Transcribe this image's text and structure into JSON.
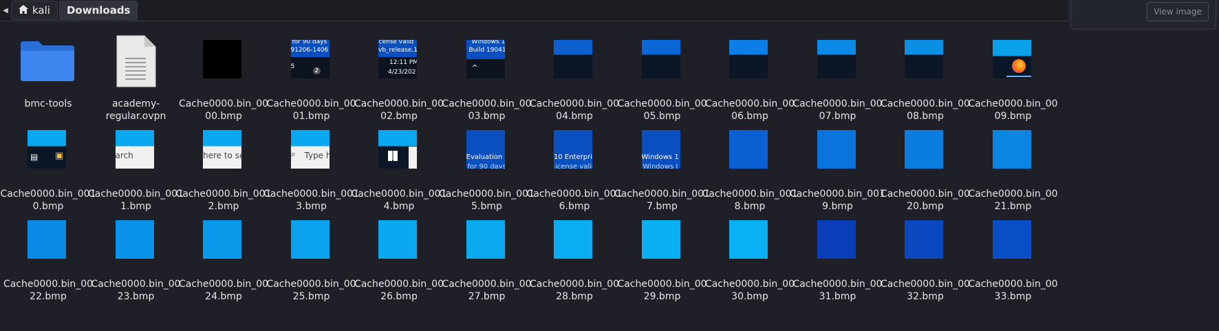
{
  "breadcrumb": {
    "home": "kali",
    "current": "Downloads"
  },
  "view_image_label": "View image",
  "rows": [
    [
      {
        "name": "bmc-tools",
        "kind": "folder"
      },
      {
        "name": "academy-regular.ovpn",
        "kind": "doc",
        "l1": "academy-",
        "l2": "regular.ovpn"
      },
      {
        "l1": "Cache0000.bin_00",
        "l2": "00.bmp",
        "kind": "black"
      },
      {
        "l1": "Cache0000.bin_00",
        "l2": "01.bmp",
        "kind": "thumb01"
      },
      {
        "l1": "Cache0000.bin_00",
        "l2": "02.bmp",
        "kind": "thumb02"
      },
      {
        "l1": "Cache0000.bin_00",
        "l2": "03.bmp",
        "kind": "thumb03"
      },
      {
        "l1": "Cache0000.bin_00",
        "l2": "04.bmp",
        "kind": "split",
        "top": "#0b5fcf",
        "bottom": "#0b1726"
      },
      {
        "l1": "Cache0000.bin_00",
        "l2": "05.bmp",
        "kind": "split",
        "top": "#0a67d8",
        "bottom": "#0b1726"
      },
      {
        "l1": "Cache0000.bin_00",
        "l2": "06.bmp",
        "kind": "split",
        "top": "#0d7de8",
        "bottom": "#0b1726"
      },
      {
        "l1": "Cache0000.bin_00",
        "l2": "07.bmp",
        "kind": "split",
        "top": "#0a8ae6",
        "bottom": "#0b1726"
      },
      {
        "l1": "Cache0000.bin_00",
        "l2": "08.bmp",
        "kind": "split",
        "top": "#0a8fe4",
        "bottom": "#0b1726"
      },
      {
        "l1": "Cache0000.bin_00",
        "l2": "09.bmp",
        "kind": "thumb09"
      }
    ],
    [
      {
        "l1": "Cache0000.bin_001",
        "l2": "0.bmp",
        "kind": "thumb10"
      },
      {
        "l1": "Cache0000.bin_001",
        "l2": "1.bmp",
        "kind": "search",
        "text": "arch"
      },
      {
        "l1": "Cache0000.bin_001",
        "l2": "2.bmp",
        "kind": "search",
        "text": "here to sea"
      },
      {
        "l1": "Cache0000.bin_001",
        "l2": "3.bmp",
        "kind": "search2",
        "text": "Type h"
      },
      {
        "l1": "Cache0000.bin_001",
        "l2": "4.bmp",
        "kind": "thumb14"
      },
      {
        "l1": "Cache0000.bin_001",
        "l2": "5.bmp",
        "kind": "bluetext",
        "t1": "Evaluation",
        "t2": "for 90 days"
      },
      {
        "l1": "Cache0000.bin_001",
        "l2": "6.bmp",
        "kind": "bluetext",
        "t1": "10 Enterprise",
        "t2": "icense valid"
      },
      {
        "l1": "Cache0000.bin_001",
        "l2": "7.bmp",
        "kind": "bluetext",
        "t1": "Windows 1",
        "t2": "Windows I"
      },
      {
        "l1": "Cache0000.bin_001",
        "l2": "8.bmp",
        "kind": "solid",
        "color": "#0a5fd2"
      },
      {
        "l1": "Cache0000.bin_001",
        "l2": "9.bmp",
        "kind": "solid",
        "color": "#0a74dc"
      },
      {
        "l1": "Cache0000.bin_00",
        "l2": "20.bmp",
        "kind": "solid",
        "color": "#0a7ee0"
      },
      {
        "l1": "Cache0000.bin_00",
        "l2": "21.bmp",
        "kind": "solid",
        "color": "#0a86e2"
      }
    ],
    [
      {
        "l1": "Cache0000.bin_00",
        "l2": "22.bmp",
        "kind": "solid",
        "color": "#0a8ce6"
      },
      {
        "l1": "Cache0000.bin_00",
        "l2": "23.bmp",
        "kind": "solid",
        "color": "#0a92e8"
      },
      {
        "l1": "Cache0000.bin_00",
        "l2": "24.bmp",
        "kind": "solid",
        "color": "#0a98ea"
      },
      {
        "l1": "Cache0000.bin_00",
        "l2": "25.bmp",
        "kind": "solid",
        "color": "#0aa2ee"
      },
      {
        "l1": "Cache0000.bin_00",
        "l2": "26.bmp",
        "kind": "solid",
        "color": "#0aa8f0"
      },
      {
        "l1": "Cache0000.bin_00",
        "l2": "27.bmp",
        "kind": "solid",
        "color": "#0aaaf0"
      },
      {
        "l1": "Cache0000.bin_00",
        "l2": "28.bmp",
        "kind": "solid",
        "color": "#0aacf2"
      },
      {
        "l1": "Cache0000.bin_00",
        "l2": "29.bmp",
        "kind": "solid",
        "color": "#0aaef2"
      },
      {
        "l1": "Cache0000.bin_00",
        "l2": "30.bmp",
        "kind": "solid",
        "color": "#0ab0f4"
      },
      {
        "l1": "Cache0000.bin_00",
        "l2": "31.bmp",
        "kind": "solid",
        "color": "#0a3eb8"
      },
      {
        "l1": "Cache0000.bin_00",
        "l2": "32.bmp",
        "kind": "solid",
        "color": "#0a48c0"
      },
      {
        "l1": "Cache0000.bin_00",
        "l2": "33.bmp",
        "kind": "solid",
        "color": "#0a4ec6"
      }
    ]
  ],
  "thumb_text": {
    "t01a": "for 90 days",
    "t01b": "91206-1406",
    "t01c": "2",
    "t02a": "icense valid",
    "t02b": "vb_release.1",
    "t02c": "12:11 PM",
    "t02d": "4/23/202",
    "t03a": "Windows 1",
    "t03b": "Build 19041."
  }
}
